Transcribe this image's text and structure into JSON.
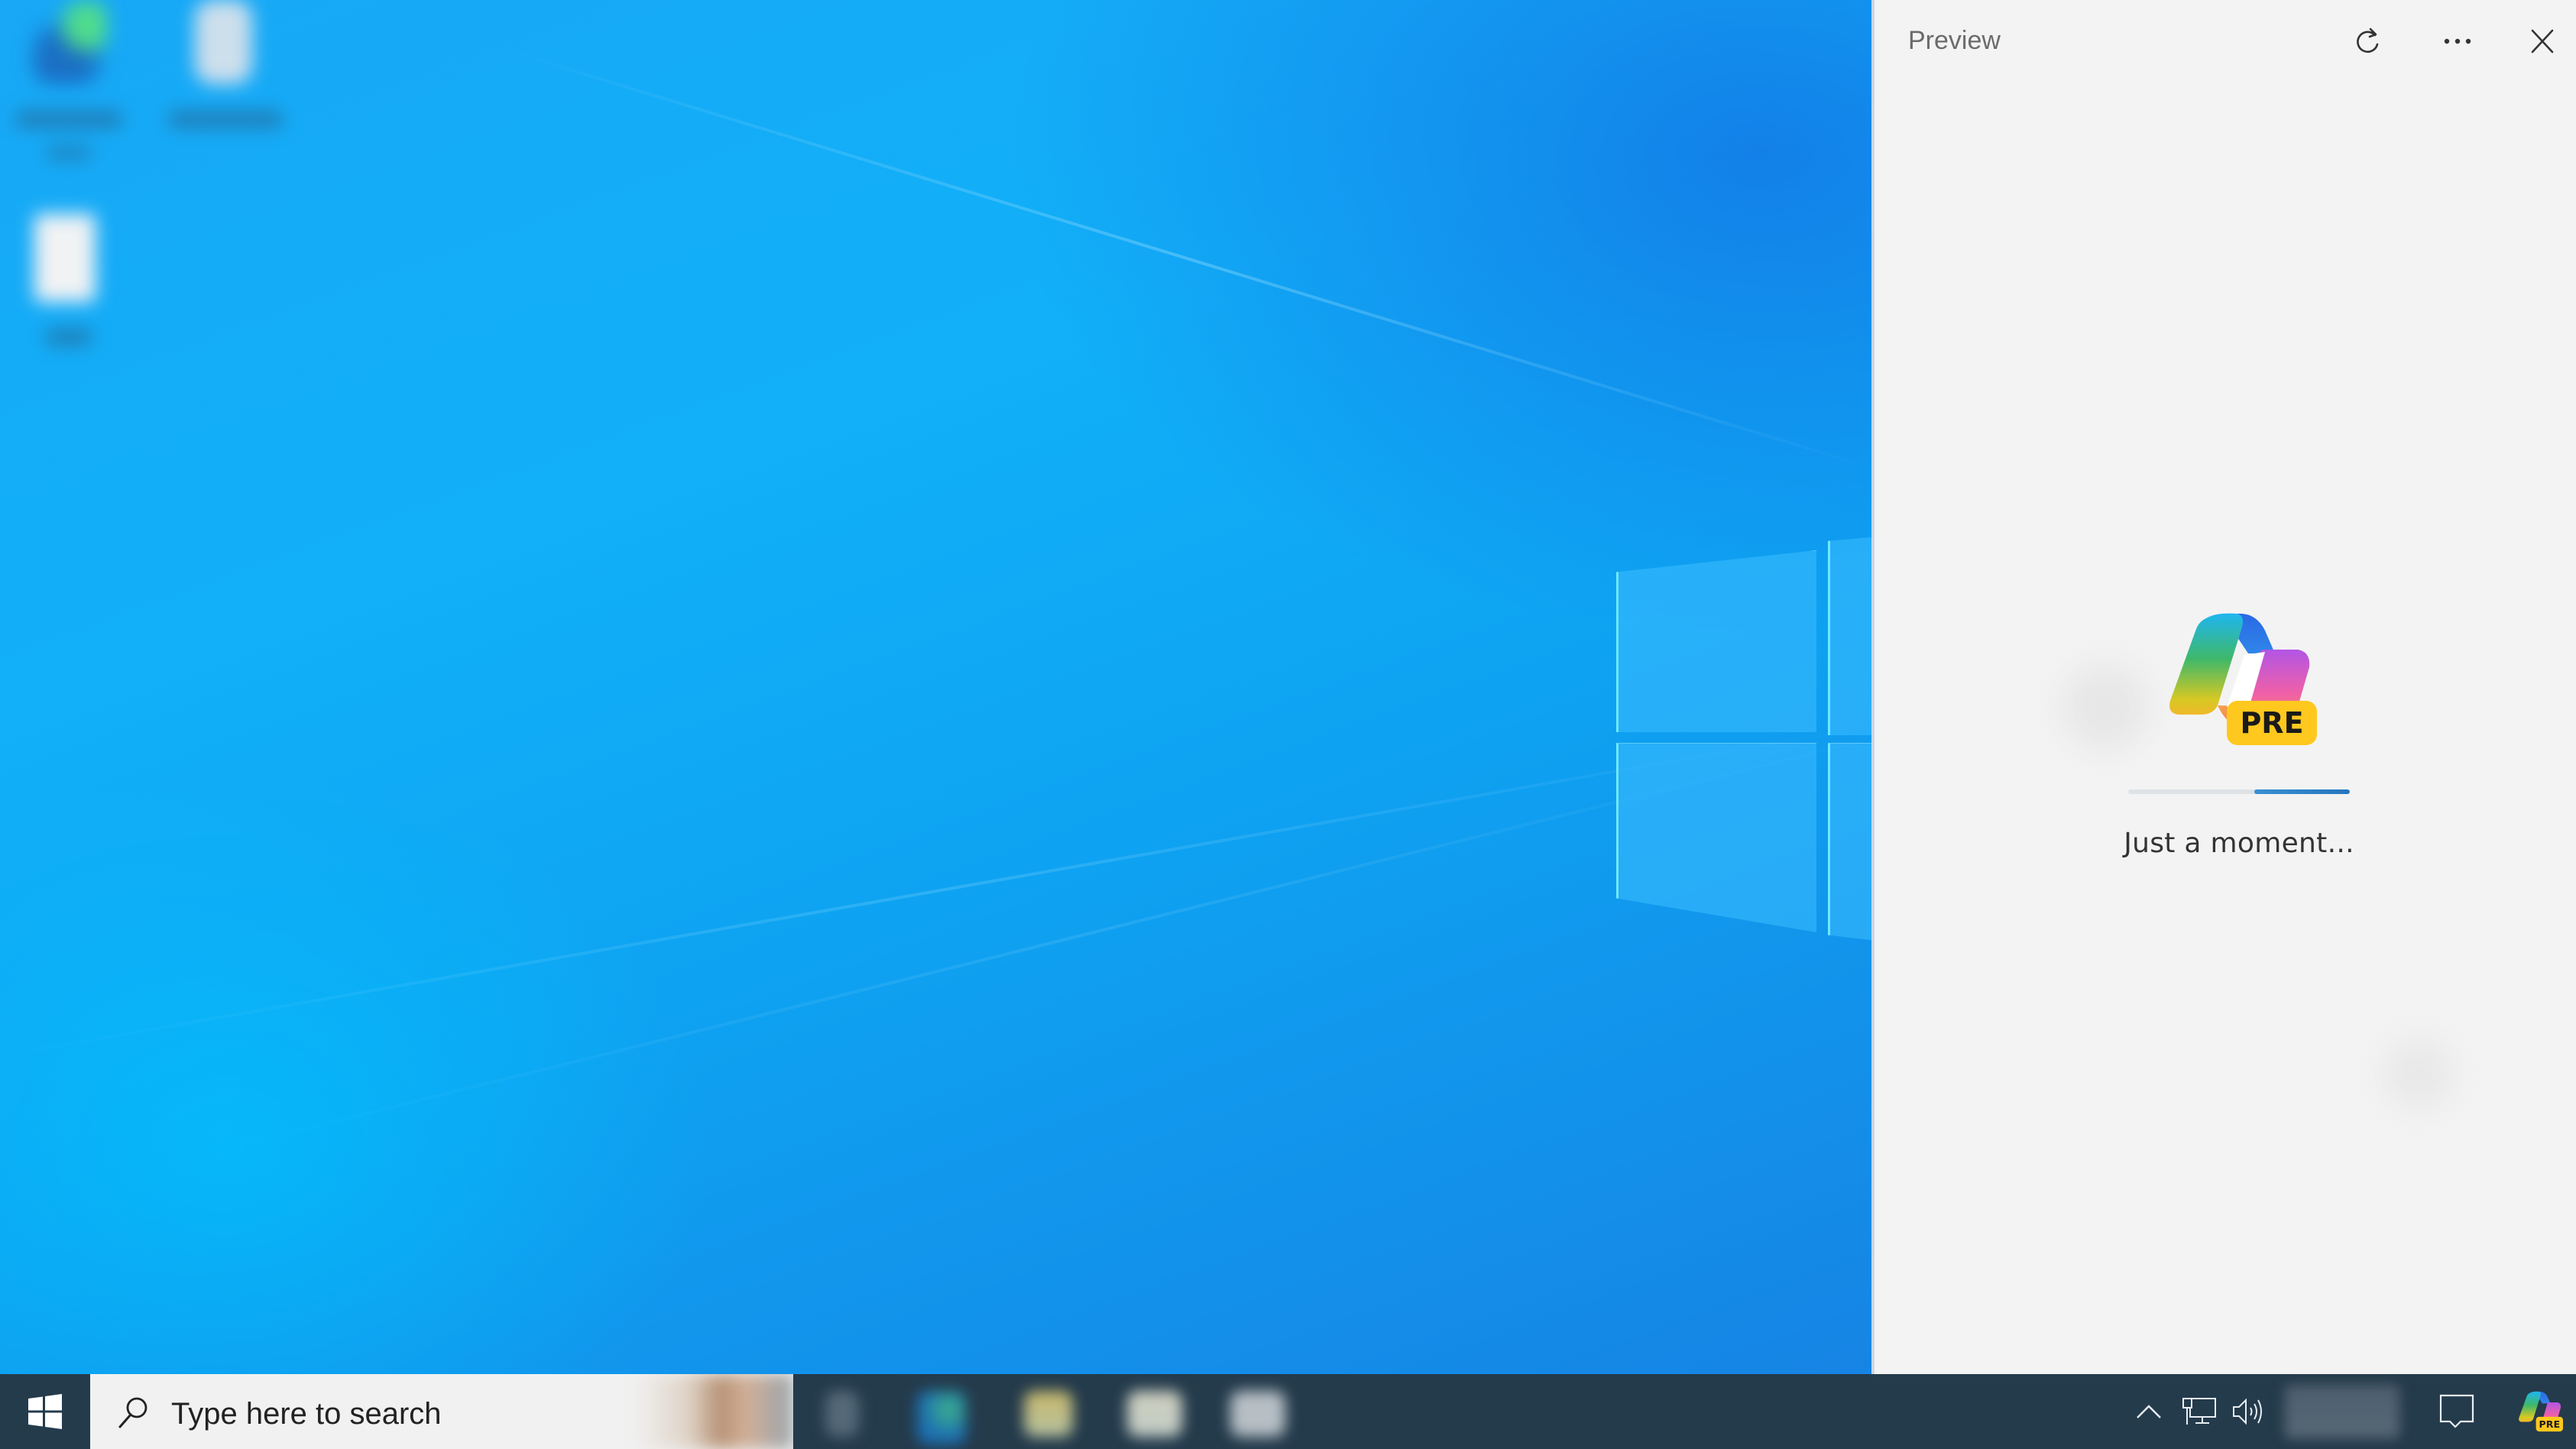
{
  "desktop": {
    "icons": [
      {
        "name": "browser-shortcut",
        "label": ""
      },
      {
        "name": "recycle-bin",
        "label": ""
      },
      {
        "name": "file",
        "label": ""
      }
    ]
  },
  "panel": {
    "title": "Preview",
    "buttons": {
      "refresh": "refresh-icon",
      "more": "more-options-icon",
      "close": "close-icon"
    },
    "logo_badge": "PRE",
    "progress_start": 0.57,
    "progress_end": 1.0,
    "loading_text": "Just a moment..."
  },
  "taskbar": {
    "search_placeholder": "Type here to search",
    "apps": [
      "task-view",
      "edge",
      "file-explorer",
      "store",
      "mail"
    ],
    "tray": {
      "notification_badge": "PRE"
    }
  },
  "colors": {
    "taskbar_bg": "#243b4c",
    "panel_bg": "#f3f3f3",
    "progress_fill": "#2e82c8",
    "badge_yellow": "#ffc81e"
  }
}
